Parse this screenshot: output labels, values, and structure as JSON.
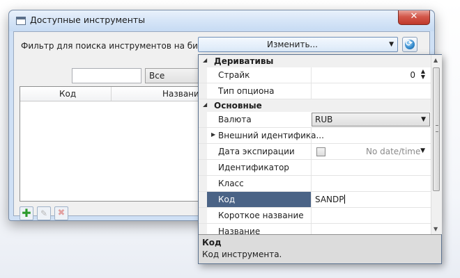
{
  "window": {
    "title": "Доступные инструменты",
    "close_glyph": "✕"
  },
  "filter": {
    "label": "Фильтр для поиска инструментов на бирже:",
    "button_label": "Изменить..."
  },
  "search": {
    "value": ""
  },
  "type_filter": {
    "selected": "Все"
  },
  "grid": {
    "columns": [
      "Код",
      "Название"
    ]
  },
  "toolbar": {
    "add_glyph": "✚",
    "edit_glyph": "✎",
    "delete_glyph": "✖"
  },
  "properties": {
    "categories": [
      "Деривативы",
      "Основные"
    ],
    "strike": {
      "label": "Страйк",
      "value": "0"
    },
    "option_type": {
      "label": "Тип опциона"
    },
    "currency": {
      "label": "Валюта",
      "value": "RUB"
    },
    "external_id": {
      "label": "Внешний идентифика..."
    },
    "expiry": {
      "label": "Дата экспирации",
      "placeholder": "No date/time"
    },
    "identifier": {
      "label": "Идентификатор"
    },
    "class": {
      "label": "Класс"
    },
    "code": {
      "label": "Код",
      "value": "SANDP"
    },
    "short_name": {
      "label": "Короткое название"
    },
    "name": {
      "label": "Название"
    }
  },
  "description": {
    "title": "Код",
    "text": "Код инструмента."
  }
}
